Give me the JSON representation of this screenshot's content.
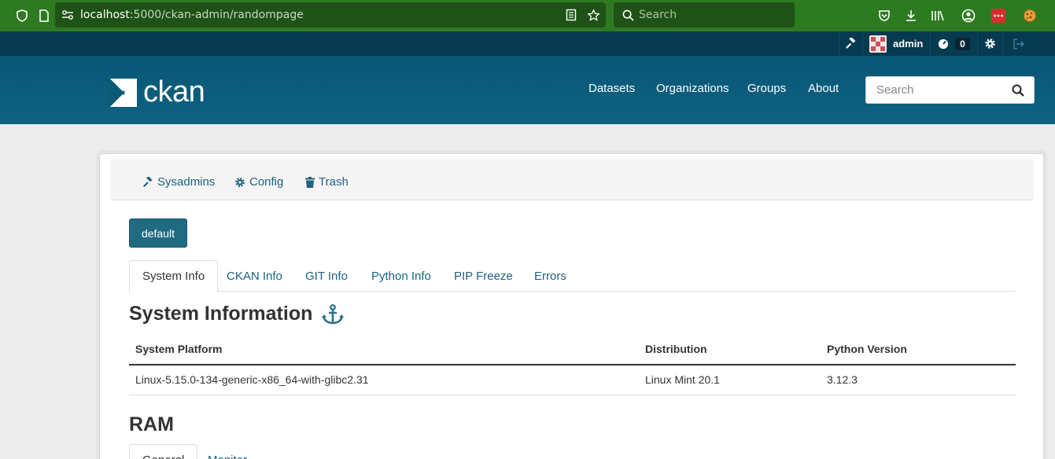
{
  "browser": {
    "url_host": "localhost",
    "url_path": ":5000/ckan-admin/randompage",
    "search_placeholder": "Search"
  },
  "account": {
    "username": "admin",
    "activity_count": "0"
  },
  "site": {
    "logo_text": "ckan",
    "nav": [
      "Datasets",
      "Organizations",
      "Groups",
      "About"
    ],
    "search_placeholder": "Search"
  },
  "admin_tabs": [
    "Sysadmins",
    "Config",
    "Trash"
  ],
  "default_button": "default",
  "info_tabs": [
    "System Info",
    "CKAN Info",
    "GIT Info",
    "Python Info",
    "PIP Freeze",
    "Errors"
  ],
  "system_info": {
    "heading": "System Information",
    "columns": [
      "System Platform",
      "Distribution",
      "Python Version"
    ],
    "row": [
      "Linux-5.15.0-134-generic-x86_64-with-glibc2.31",
      "Linux Mint 20.1",
      "3.12.3"
    ]
  },
  "ram": {
    "heading": "RAM",
    "tabs": [
      "General",
      "Monitor"
    ]
  },
  "colors": {
    "browser_green": "#2e7a20",
    "account_bar": "#063a4f",
    "masthead": "#0b5a78",
    "link": "#1d6281",
    "button": "#206b82"
  }
}
